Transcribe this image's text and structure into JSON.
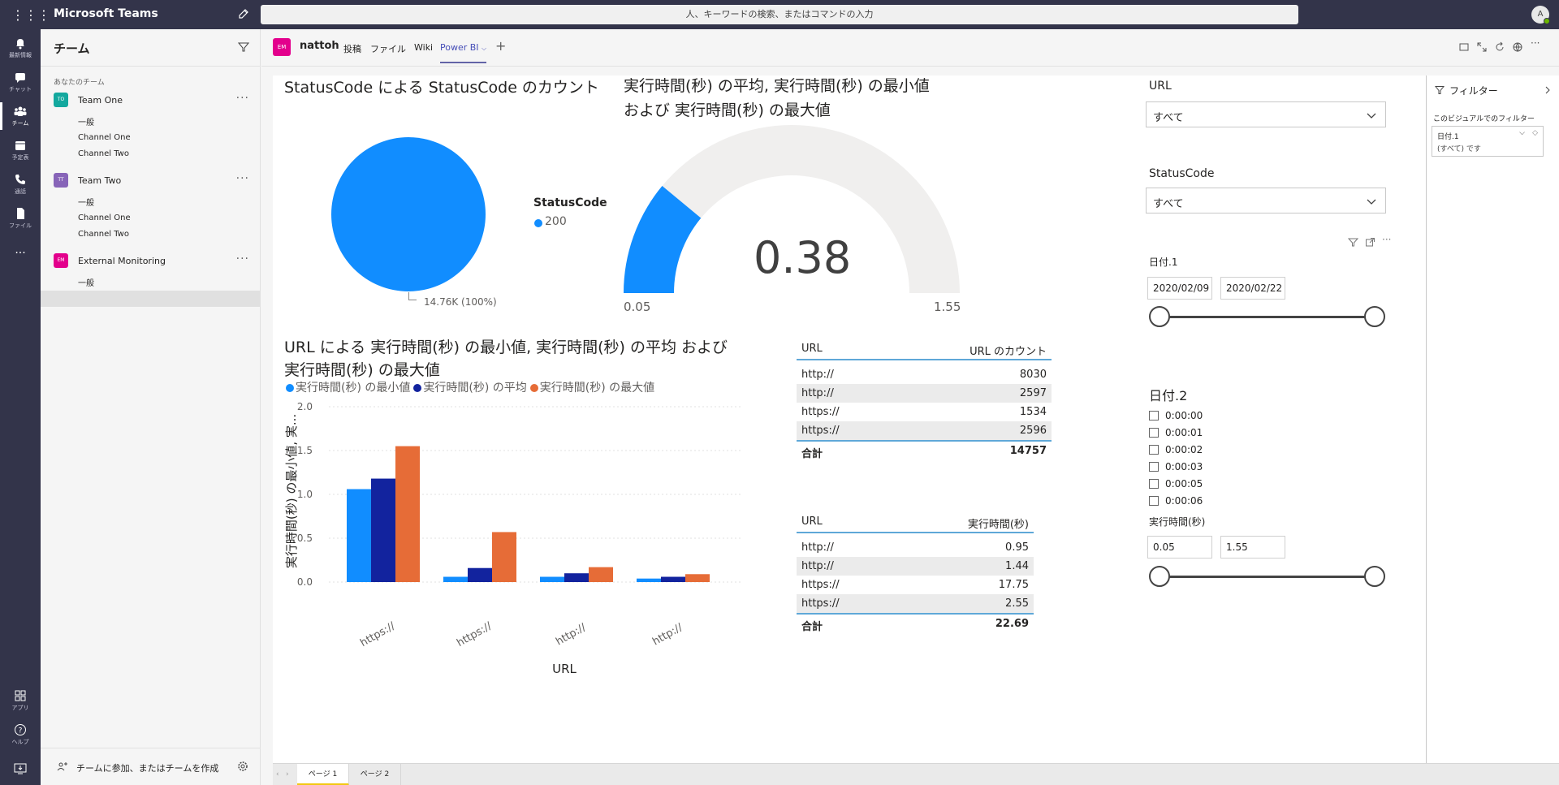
{
  "app": {
    "title": "Microsoft Teams",
    "search_placeholder": "人、キーワードの検索、またはコマンドの入力",
    "avatar": "A"
  },
  "rail": [
    {
      "label": "最新情報",
      "icon": "bell-icon"
    },
    {
      "label": "チャット",
      "icon": "chat-icon"
    },
    {
      "label": "チーム",
      "icon": "teams-icon",
      "active": true
    },
    {
      "label": "予定表",
      "icon": "calendar-icon"
    },
    {
      "label": "通話",
      "icon": "call-icon"
    },
    {
      "label": "ファイル",
      "icon": "file-icon"
    },
    {
      "label": "...",
      "icon": "more-icon"
    }
  ],
  "rail_bottom": [
    {
      "label": "アプリ",
      "icon": "apps-icon"
    },
    {
      "label": "ヘルプ",
      "icon": "help-icon"
    }
  ],
  "panel": {
    "title": "チーム",
    "section": "あなたのチーム",
    "teams": [
      {
        "initials": "TO",
        "name": "Team One",
        "color": "#13a89e",
        "channels": [
          "一般",
          "Channel One",
          "Channel Two"
        ]
      },
      {
        "initials": "TT",
        "name": "Team Two",
        "color": "#8764b8",
        "channels": [
          "一般",
          "Channel One",
          "Channel Two"
        ]
      },
      {
        "initials": "EM",
        "name": "External Monitoring",
        "color": "#e3008c",
        "channels": [
          "一般"
        ]
      }
    ],
    "footer": "チームに参加、またはチームを作成"
  },
  "channel": {
    "avatar": "EM",
    "name": "nattoh",
    "tabs": [
      "投稿",
      "ファイル",
      "Wiki",
      "Power BI"
    ],
    "active_tab": "Power BI"
  },
  "report": {
    "pie": {
      "title": "StatusCode による StatusCode のカウント",
      "legend_title": "StatusCode",
      "legend_item": "200",
      "data_label": "14.76K (100%)",
      "color": "#118dff"
    },
    "gauge": {
      "title_line1": "実行時間(秒) の平均, 実行時間(秒) の最小値",
      "title_line2": "および 実行時間(秒) の最大値",
      "value_label": "0.38",
      "min_label": "0.05",
      "max_label": "1.55"
    },
    "bar": {
      "title_line1": "URL による 実行時間(秒) の最小値, 実行時間(秒) の平均 および",
      "title_line2": "実行時間(秒) の最大値",
      "ylabel": "実行時間(秒) の最小値, 実...",
      "xlabel": "URL"
    },
    "table1": {
      "headers": [
        "URL",
        "URL のカウント"
      ],
      "rows": [
        [
          "http://",
          "8030"
        ],
        [
          "http://",
          "2597"
        ],
        [
          "https://",
          "1534"
        ],
        [
          "https://",
          "2596"
        ]
      ],
      "total_label": "合計",
      "total_value": "14757"
    },
    "table2": {
      "headers": [
        "URL",
        "実行時間(秒)"
      ],
      "rows": [
        [
          "http://",
          "0.95"
        ],
        [
          "http://",
          "1.44"
        ],
        [
          "https://",
          "17.75"
        ],
        [
          "https://",
          "2.55"
        ]
      ],
      "total_label": "合計",
      "total_value": "22.69"
    },
    "slicers": {
      "url": {
        "title": "URL",
        "value": "すべて"
      },
      "status": {
        "title": "StatusCode",
        "value": "すべて"
      },
      "date1": {
        "title": "日付.1",
        "from": "2020/02/09",
        "to": "2020/02/22"
      },
      "date2": {
        "title": "日付.2",
        "items": [
          "0:00:00",
          "0:00:01",
          "0:00:02",
          "0:00:03",
          "0:00:05",
          "0:00:06"
        ]
      },
      "exec": {
        "title": "実行時間(秒)",
        "from": "0.05",
        "to": "1.55"
      }
    }
  },
  "filters": {
    "title": "フィルター",
    "subtitle": "このビジュアルでのフィルター",
    "card_name": "日付.1",
    "card_value": "(すべて) です"
  },
  "pages": [
    "ページ 1",
    "ページ 2"
  ],
  "chart_data": [
    {
      "type": "pie",
      "title": "StatusCode による StatusCode のカウント",
      "legend_title": "StatusCode",
      "categories": [
        "200"
      ],
      "values": [
        14757
      ]
    },
    {
      "type": "gauge",
      "title": "実行時間(秒) の平均, 実行時間(秒) の最小値 および 実行時間(秒) の最大値",
      "value": 0.38,
      "min": 0.05,
      "max": 1.55
    },
    {
      "type": "bar",
      "title": "URL による 実行時間(秒) の最小値, 実行時間(秒) の平均 および 実行時間(秒) の最大値",
      "xlabel": "URL",
      "ylabel": "実行時間(秒) の最小値, 実...",
      "categories": [
        "https://",
        "https://",
        "http://",
        "http://"
      ],
      "series": [
        {
          "name": "実行時間(秒) の最小値",
          "color": "#118dff",
          "values": [
            1.06,
            0.06,
            0.06,
            0.04
          ]
        },
        {
          "name": "実行時間(秒) の平均",
          "color": "#12239e",
          "values": [
            1.18,
            0.16,
            0.1,
            0.06
          ]
        },
        {
          "name": "実行時間(秒) の最大値",
          "color": "#e66c37",
          "values": [
            1.55,
            0.57,
            0.17,
            0.09
          ]
        }
      ],
      "ylim": [
        0,
        2.0
      ],
      "yticks": [
        "0.0",
        "0.5",
        "1.0",
        "1.5",
        "2.0"
      ]
    }
  ]
}
